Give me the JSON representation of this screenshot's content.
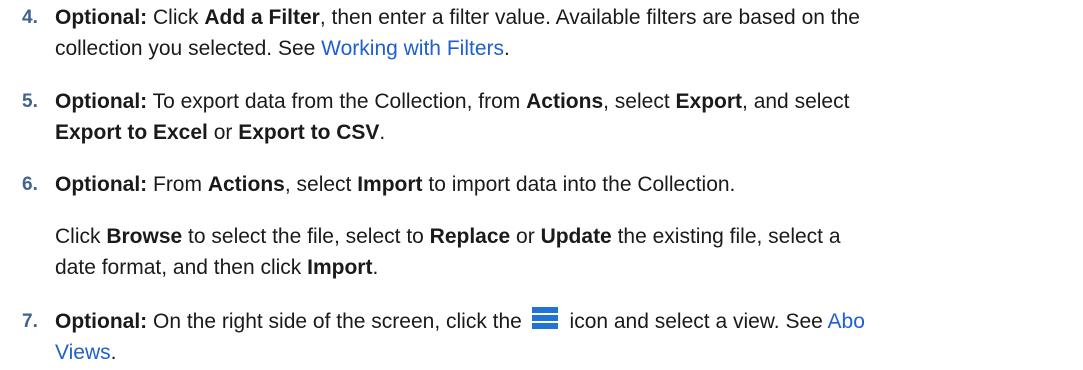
{
  "steps": [
    {
      "number": "4.",
      "lead": "Optional:",
      "t1": " Click ",
      "b1": "Add a Filter",
      "t2": ", then enter a filter value. Available filters are based on the",
      "t3": "collection you selected. See ",
      "link": "Working with Filters",
      "t4": "."
    },
    {
      "number": "5.",
      "lead": "Optional:",
      "t1": " To export data from the Collection, from ",
      "b1": "Actions",
      "t2": ", select ",
      "b2": "Export",
      "t3": ", and select",
      "b3": "Export to Excel",
      "t4": " or ",
      "b4": "Export to CSV",
      "t5": "."
    },
    {
      "number": "6.",
      "lead": "Optional:",
      "t1": " From ",
      "b1": "Actions",
      "t2": ", select ",
      "b2": "Import",
      "t3": " to import data into the Collection.",
      "p2_t1": "Click ",
      "p2_b1": "Browse",
      "p2_t2": " to select the file, select to ",
      "p2_b2": "Replace",
      "p2_t3": " or ",
      "p2_b3": "Update",
      "p2_t4": " the existing file, select a",
      "p2_t5": "date format, and then click ",
      "p2_b4": "Import",
      "p2_t6": "."
    },
    {
      "number": "7.",
      "lead": "Optional:",
      "t1": " On the right side of the screen, click the ",
      "icon": "hamburger-menu-icon",
      "t2": " icon and select a view. See ",
      "link_part1": "Abo",
      "link_part2": "Views",
      "t3": "."
    }
  ],
  "colors": {
    "step_number": "#41628e",
    "link": "#1f5fd1",
    "icon": "#1f74d6"
  }
}
